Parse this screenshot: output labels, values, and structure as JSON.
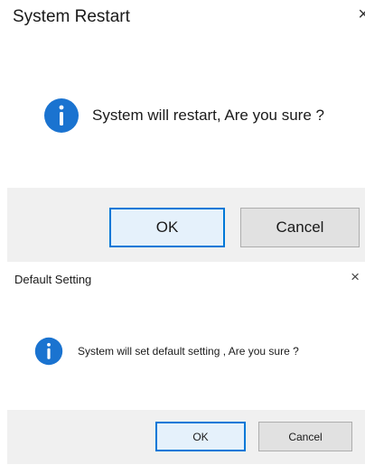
{
  "restart_dialog": {
    "title": "System Restart",
    "close_glyph": "×",
    "icon": "info-icon",
    "message": "System will restart, Are you sure ?",
    "ok_label": "OK",
    "cancel_label": "Cancel"
  },
  "default_dialog": {
    "title": "Default Setting",
    "close_glyph": "×",
    "icon": "info-icon",
    "message": "System will set default setting , Are you sure ?",
    "ok_label": "OK",
    "cancel_label": "Cancel"
  },
  "colors": {
    "info_icon": "#1a73d0",
    "accent_border": "#0078d7",
    "footer_bg": "#f0f0f0"
  }
}
